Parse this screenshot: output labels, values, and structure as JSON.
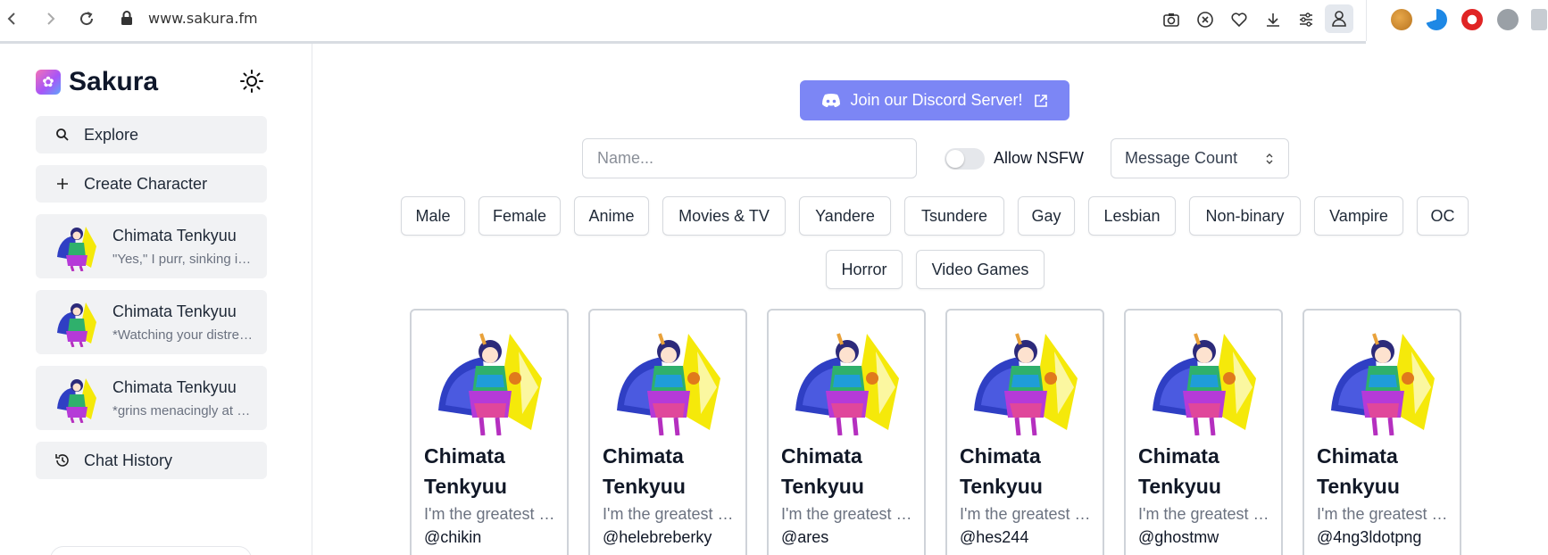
{
  "browser": {
    "url": "www.sakura.fm"
  },
  "sidebar": {
    "brand": "Sakura",
    "explore_label": "Explore",
    "create_label": "Create Character",
    "recent_chats": [
      {
        "name": "Chimata Tenkyuu",
        "preview": "\"Yes,\" I purr, sinking into your embrace"
      },
      {
        "name": "Chimata Tenkyuu",
        "preview": "*Watching your distress with a smile"
      },
      {
        "name": "Chimata Tenkyuu",
        "preview": "*grins menacingly at you"
      }
    ],
    "history_label": "Chat History"
  },
  "main": {
    "discord_label": "Join our Discord Server!",
    "search_placeholder": "Name...",
    "nsfw_label": "Allow NSFW",
    "nsfw_enabled": false,
    "sort_value": "Message Count",
    "tags": [
      "Male",
      "Female",
      "Anime",
      "Movies & TV",
      "Yandere",
      "Tsundere",
      "Gay",
      "Lesbian",
      "Non-binary",
      "Vampire",
      "OC",
      "Horror",
      "Video Games"
    ],
    "cards": [
      {
        "title": "Chimata Tenkyuu",
        "description": "I'm the greatest god of the market",
        "author": "@chikin"
      },
      {
        "title": "Chimata Tenkyuu",
        "description": "I'm the greatest god of the market",
        "author": "@helebreberky"
      },
      {
        "title": "Chimata Tenkyuu",
        "description": "I'm the greatest god of the market",
        "author": "@ares"
      },
      {
        "title": "Chimata Tenkyuu",
        "description": "I'm the greatest god of the market",
        "author": "@hes244"
      },
      {
        "title": "Chimata Tenkyuu",
        "description": "I'm the greatest god of the market",
        "author": "@ghostmw"
      },
      {
        "title": "Chimata Tenkyuu",
        "description": "I'm the greatest god of the market",
        "author": "@4ng3ldotpng"
      }
    ]
  },
  "colors": {
    "discord_button": "#7c86f5",
    "sidebar_button_bg": "#f1f2f4",
    "border": "#d6d9de"
  },
  "icons": [
    "back-icon",
    "forward-icon",
    "reload-icon",
    "lock-icon",
    "camera-icon",
    "shield-icon",
    "heart-icon",
    "download-icon",
    "sliders-icon",
    "profile-icon",
    "sun-icon",
    "search-icon",
    "plus-icon",
    "history-icon",
    "discord-icon",
    "external-link-icon",
    "chevron-updown-icon"
  ]
}
